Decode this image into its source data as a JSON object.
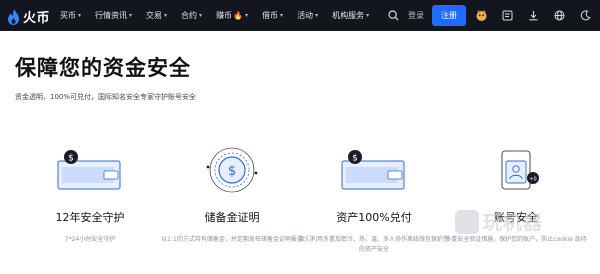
{
  "brand": {
    "name": "火币"
  },
  "nav": {
    "items": [
      {
        "label": "买币",
        "caret": "▾"
      },
      {
        "label": "行情资讯",
        "caret": "▾"
      },
      {
        "label": "交易",
        "caret": "▾"
      },
      {
        "label": "合约",
        "caret": "▾"
      },
      {
        "label": "赚币",
        "caret": "▾",
        "fire": "🔥"
      },
      {
        "label": "借币",
        "caret": "▾"
      },
      {
        "label": "活动",
        "caret": "▾"
      },
      {
        "label": "机构服务",
        "caret": "▾"
      }
    ],
    "login": "登录",
    "register": "注册"
  },
  "hero": {
    "title": "保障您的资金安全",
    "subtitle": "资金透明，100%可兑付，国际知名安全专家守护账号安全"
  },
  "features": [
    {
      "title": "12年安全守护",
      "desc": "7*24小时安全守护"
    },
    {
      "title": "储备金证明",
      "desc": "以1:1的方式持有储备金，并定期发布储备金证明报告"
    },
    {
      "title": "资产100%兑付",
      "desc": "我们利用多重加密冷、热、温、多人协作离线钱包保护您的资产安全"
    },
    {
      "title": "账号安全",
      "desc": "多重安全验证措施，保护您的账户，防止cookie 劫持"
    }
  ],
  "watermark": {
    "text": "玩机器"
  },
  "colors": {
    "nav_bg": "#14161f",
    "accent": "#1f6bff",
    "illustration": "#2f6bd8"
  }
}
